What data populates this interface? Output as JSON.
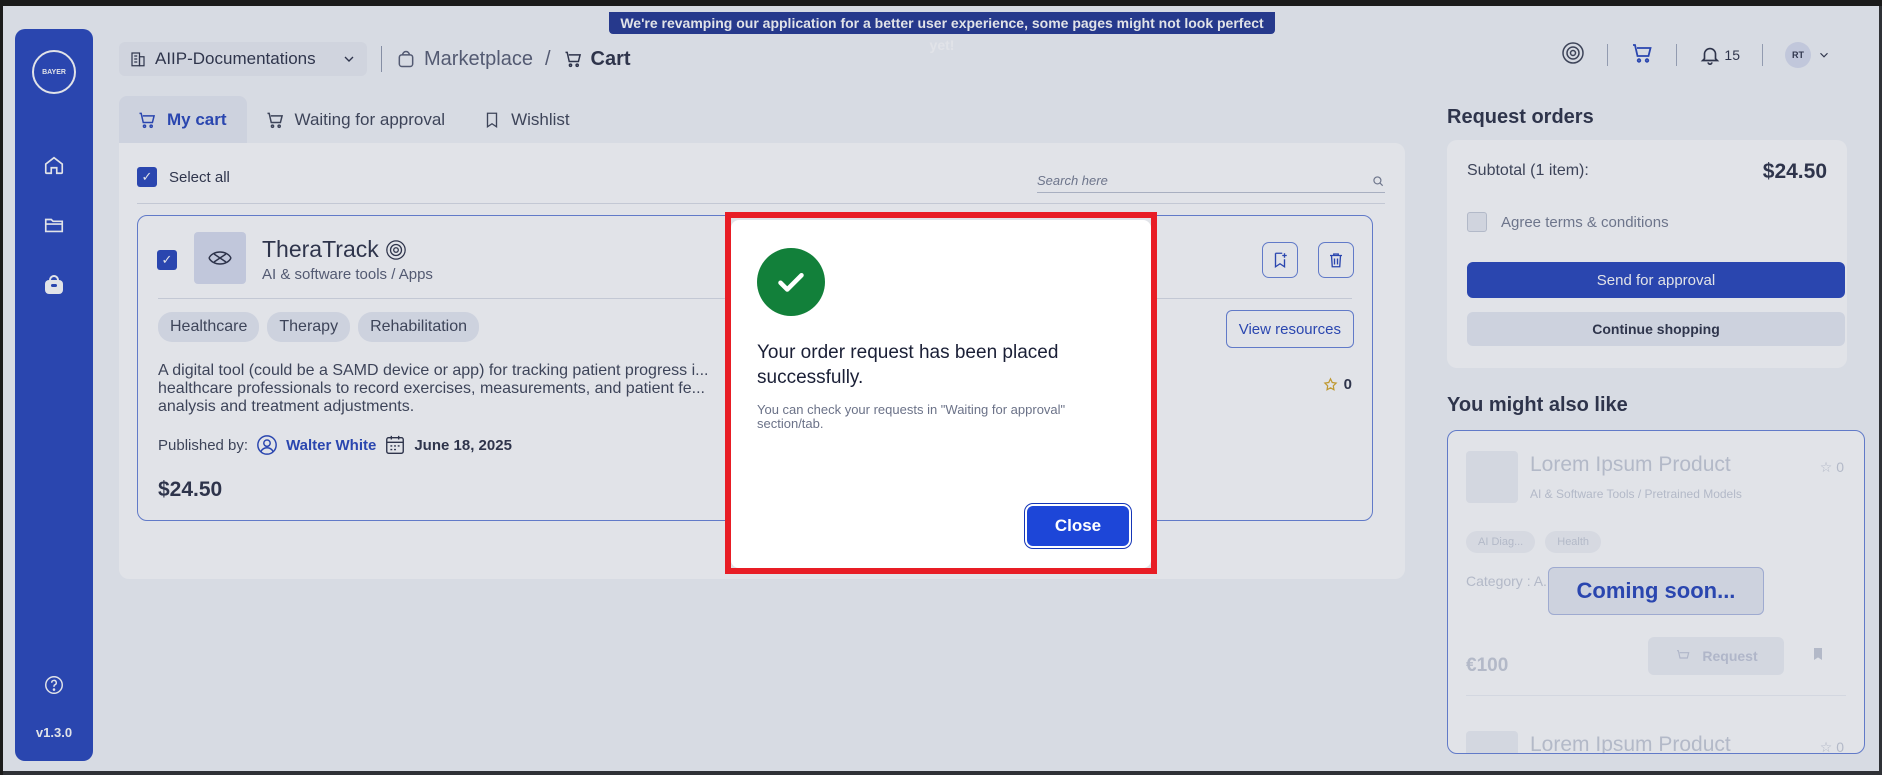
{
  "banner": "We're revamping our application for a better user experience, some pages might not look perfect yet!",
  "sidebar": {
    "logo_text": "BAYER",
    "version": "v1.3.0",
    "icons": [
      "home-icon",
      "folder-icon",
      "marketplace-icon",
      "help-icon"
    ]
  },
  "topbar": {
    "org": "AIIP-Documentations",
    "breadcrumb": [
      "Marketplace",
      "Cart"
    ],
    "notification_count": "15",
    "avatar_initials": "RT"
  },
  "tabs": [
    {
      "label": "My cart",
      "active": true
    },
    {
      "label": "Waiting for approval",
      "active": false
    },
    {
      "label": "Wishlist",
      "active": false
    }
  ],
  "cart": {
    "select_all": "Select all",
    "search_placeholder": "Search here",
    "item": {
      "name": "TheraTrack",
      "category": "AI & software tools / Apps",
      "tags": [
        "Healthcare",
        "Therapy",
        "Rehabilitation"
      ],
      "view_resources": "View resources",
      "description": "A digital tool (could be a SAMD device or app) for tracking patient progress i... healthcare professionals to record exercises, measurements, and patient fe... analysis and treatment adjustments.",
      "rating": "0",
      "published_by_label": "Published by:",
      "author": "Walter White",
      "date": "June 18, 2025",
      "price": "$24.50"
    }
  },
  "orders": {
    "title": "Request orders",
    "subtotal_label": "Subtotal (1 item):",
    "subtotal_value": "$24.50",
    "agree_label": "Agree terms & conditions",
    "send_button": "Send for approval",
    "continue_button": "Continue shopping"
  },
  "also_like": {
    "title": "You might also like",
    "product_name": "Lorem Ipsum Product",
    "product_category": "AI & Software Tools / Pretrained Models",
    "chips": [
      "AI Diag...",
      "Health"
    ],
    "description": "Category : A... y / Pretrained M... ser",
    "price": "€100",
    "request_button": "Request",
    "rating": "0",
    "coming_soon": "Coming soon..."
  },
  "modal": {
    "title": "Your order request has been placed successfully.",
    "subtitle": "You can check your requests in \"Waiting for approval\" section/tab.",
    "close_button": "Close"
  },
  "colors": {
    "primary": "#1536b7",
    "success": "#12803a",
    "highlight": "#e81d25"
  }
}
